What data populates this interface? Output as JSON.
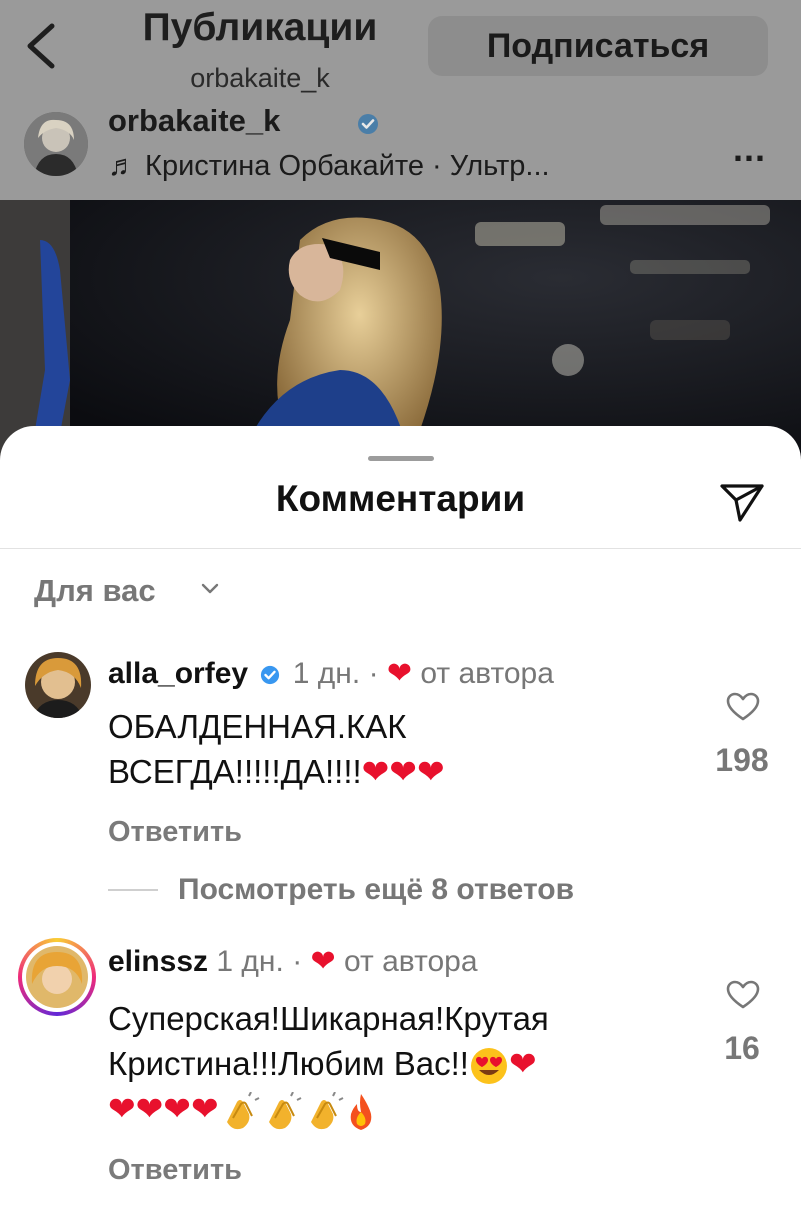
{
  "header": {
    "title": "Публикации",
    "subtitle": "orbakaite_k",
    "follow_label": "Подписаться"
  },
  "post": {
    "username": "orbakaite_k",
    "music": "♬ Кристина Орбакайте · Ультр...",
    "more": "..."
  },
  "comments_sheet": {
    "title": "Комментарии",
    "filter_label": "Для вас"
  },
  "comments": [
    {
      "username": "alla_orfey",
      "verified": true,
      "time": "1 дн.",
      "dot": "·",
      "liked_by_author": "от автора",
      "line1": "ОБАЛДЕННАЯ.КАК",
      "line2": "ВСЕГДА!!!!!ДА!!!!",
      "line2_emoji": [
        "heart",
        "heart",
        "heart"
      ],
      "likes": "198",
      "reply_label": "Ответить",
      "more_replies": "Посмотреть ещё 8 ответов"
    },
    {
      "username": "elinssz",
      "verified": false,
      "time": "1 дн.",
      "dot": "·",
      "liked_by_author": "от автора",
      "line1": "Суперская!Шикарная!Крутая",
      "line2": "Кристина!!!Любим Вас!!",
      "line2_emoji": [
        "heart-eyes",
        "heart"
      ],
      "line3_emoji": [
        "heart",
        "heart",
        "heart",
        "heart",
        "clap",
        "clap",
        "clap",
        "fire"
      ],
      "likes": "16",
      "reply_label": "Ответить"
    }
  ],
  "colors": {
    "accent_blue": "#3897f0",
    "heart_red": "#e8112d",
    "muted_text": "#777777",
    "overlay_gray": "#9a9a9a"
  }
}
